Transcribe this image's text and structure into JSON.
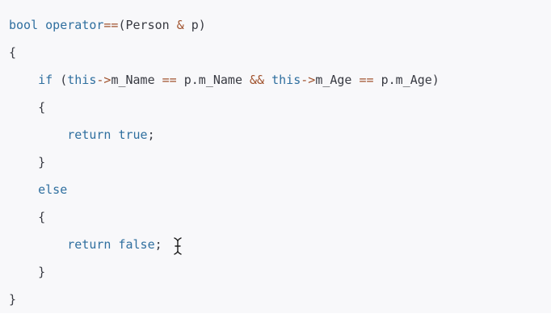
{
  "code": {
    "lines": [
      [
        {
          "t": "bool",
          "c": "kw"
        },
        {
          "t": " "
        },
        {
          "t": "operator",
          "c": "kw"
        },
        {
          "t": "==",
          "c": "op"
        },
        {
          "t": "(Person "
        },
        {
          "t": "&",
          "c": "op"
        },
        {
          "t": " p)"
        }
      ],
      [
        {
          "t": "{"
        }
      ],
      [
        {
          "t": "    "
        },
        {
          "t": "if",
          "c": "kw"
        },
        {
          "t": " ("
        },
        {
          "t": "this",
          "c": "kw"
        },
        {
          "t": "->",
          "c": "op"
        },
        {
          "t": "m_Name "
        },
        {
          "t": "==",
          "c": "op"
        },
        {
          "t": " p.m_Name "
        },
        {
          "t": "&&",
          "c": "op"
        },
        {
          "t": " "
        },
        {
          "t": "this",
          "c": "kw"
        },
        {
          "t": "->",
          "c": "op"
        },
        {
          "t": "m_Age "
        },
        {
          "t": "==",
          "c": "op"
        },
        {
          "t": " p.m_Age)"
        }
      ],
      [
        {
          "t": "    {"
        }
      ],
      [
        {
          "t": "        "
        },
        {
          "t": "return",
          "c": "kw"
        },
        {
          "t": " "
        },
        {
          "t": "true",
          "c": "kw"
        },
        {
          "t": ";"
        }
      ],
      [
        {
          "t": "    }"
        }
      ],
      [
        {
          "t": "    "
        },
        {
          "t": "else",
          "c": "kw"
        }
      ],
      [
        {
          "t": "    {"
        }
      ],
      [
        {
          "t": "        "
        },
        {
          "t": "return",
          "c": "kw"
        },
        {
          "t": " "
        },
        {
          "t": "false",
          "c": "kw"
        },
        {
          "t": ";"
        }
      ],
      [
        {
          "t": "    }"
        }
      ],
      [
        {
          "t": "}"
        }
      ]
    ]
  },
  "colors": {
    "background": "#f8f8fa",
    "keyword": "#2f6f9f",
    "operator": "#a0522d",
    "text": "#383a42"
  },
  "icons": {
    "cursor": "text-cursor-icon"
  }
}
